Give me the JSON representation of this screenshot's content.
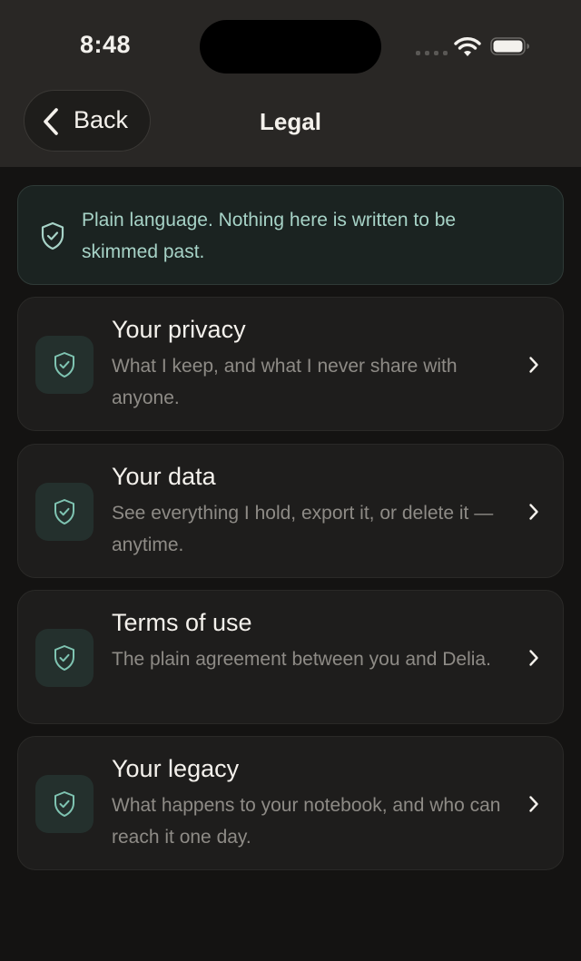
{
  "status_bar": {
    "time": "8:48"
  },
  "header": {
    "back_label": "Back",
    "title": "Legal"
  },
  "banner": {
    "text": "Plain language. Nothing here is written to be skimmed past.",
    "icon": "shield-check-icon"
  },
  "items": [
    {
      "title": "Your privacy",
      "description": "What I keep, and what I never share with anyone.",
      "icon": "shield-check-icon"
    },
    {
      "title": "Your data",
      "description": "See everything I hold, export it, or delete it — anytime.",
      "icon": "shield-check-icon"
    },
    {
      "title": "Terms of use",
      "description": "The plain agreement between you and Delia.",
      "icon": "shield-check-icon"
    },
    {
      "title": "Your legacy",
      "description": "What happens to your notebook, and who can reach it one day.",
      "icon": "shield-check-icon"
    }
  ],
  "colors": {
    "accent": "#7fc4b2",
    "background": "#141312",
    "header_background": "#292725",
    "card_background": "#1e1d1c"
  }
}
